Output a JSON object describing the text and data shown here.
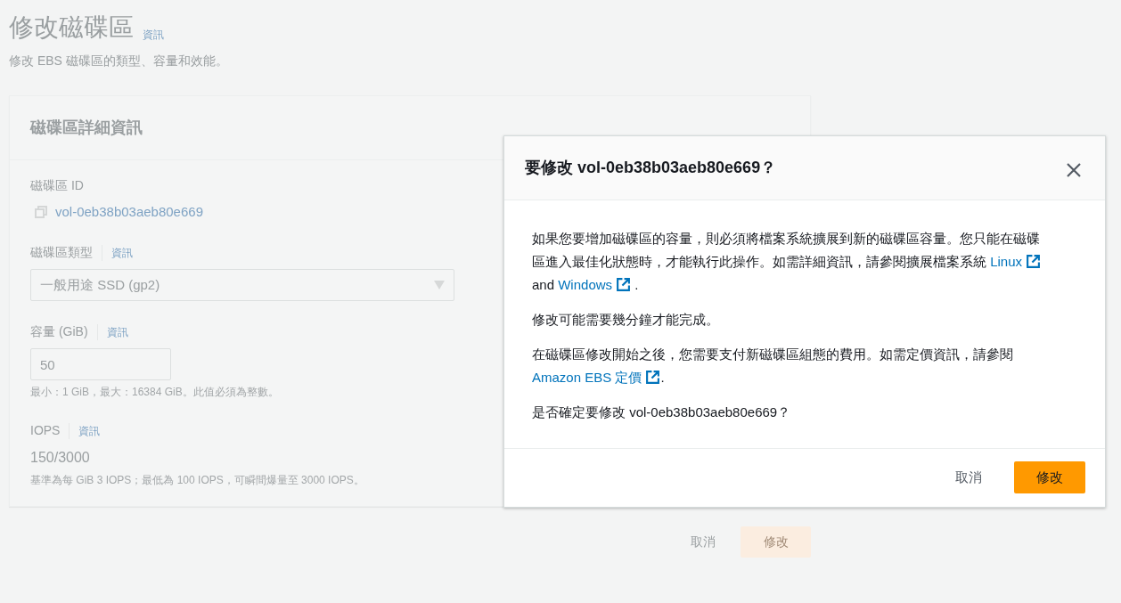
{
  "page": {
    "title": "修改磁碟區",
    "title_info": "資訊",
    "subtitle": "修改 EBS 磁碟區的類型、容量和效能。"
  },
  "card": {
    "title": "磁碟區詳細資訊",
    "volume_id": {
      "label": "磁碟區 ID",
      "value": "vol-0eb38b03aeb80e669"
    },
    "volume_type": {
      "label": "磁碟區類型",
      "info": "資訊",
      "value": "一般用途 SSD (gp2)"
    },
    "size": {
      "label": "容量 (GiB)",
      "info": "資訊",
      "value": "50",
      "hint": "最小：1 GiB，最大：16384 GiB。此值必須為整數。"
    },
    "iops": {
      "label": "IOPS",
      "info": "資訊",
      "value": "150/3000",
      "hint": "基準為每 GiB 3 IOPS；最低為 100 IOPS，可瞬間爆量至 3000 IOPS。"
    }
  },
  "page_buttons": [
    {
      "label": "取消",
      "kind": "link"
    },
    {
      "label": "修改",
      "kind": "primary"
    }
  ],
  "modal": {
    "title": "要修改 vol-0eb38b03aeb80e669？",
    "paragraphs": [
      {
        "parts": [
          {
            "kind": "text",
            "text": "如果您要增加磁碟區的容量，則必須將檔案系統擴展到新的磁碟區容量。您只能在磁碟區進入最佳化狀態時，才能執行此操作。如需詳細資訊，請參閱擴展檔案系統 "
          },
          {
            "kind": "link",
            "text": "Linux"
          },
          {
            "kind": "text",
            "text": " and "
          },
          {
            "kind": "link",
            "text": "Windows"
          },
          {
            "kind": "text",
            "text": " ."
          }
        ]
      },
      {
        "parts": [
          {
            "kind": "text",
            "text": "修改可能需要幾分鐘才能完成。"
          }
        ]
      },
      {
        "parts": [
          {
            "kind": "text",
            "text": "在磁碟區修改開始之後，您需要支付新磁碟區組態的費用。如需定價資訊，請參閱 "
          },
          {
            "kind": "link",
            "text": "Amazon EBS 定價"
          },
          {
            "kind": "text",
            "text": "."
          }
        ]
      },
      {
        "parts": [
          {
            "kind": "text",
            "text": "是否確定要修改 vol-0eb38b03aeb80e669？"
          }
        ]
      }
    ],
    "buttons": [
      {
        "label": "取消",
        "kind": "link"
      },
      {
        "label": "修改",
        "kind": "primary"
      }
    ]
  }
}
